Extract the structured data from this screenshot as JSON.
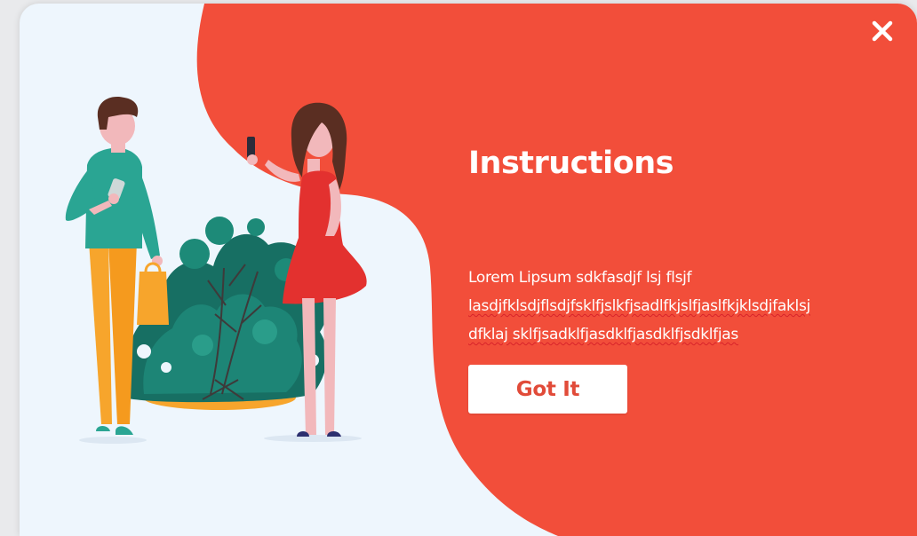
{
  "colors": {
    "accent": "#f24e3a",
    "card_background": "#eef6fd",
    "button_text": "#e14b39",
    "text_on_accent": "#ffffff"
  },
  "dialog": {
    "title": "Instructions",
    "body_lines": [
      "Lorem Lipsum sdkfasdjf lsj flsjf",
      "lasdjfklsdjflsdjfsklfjslkfjsadlfkjslfjaslfkjklsdjfaklsj",
      "dfklaj sklfjsadklfjasdklfjasdklfjsdklfjas"
    ],
    "button_label": "Got It",
    "close_icon": "close-icon"
  },
  "illustration": {
    "name": "two-people-shopping-illustration"
  }
}
